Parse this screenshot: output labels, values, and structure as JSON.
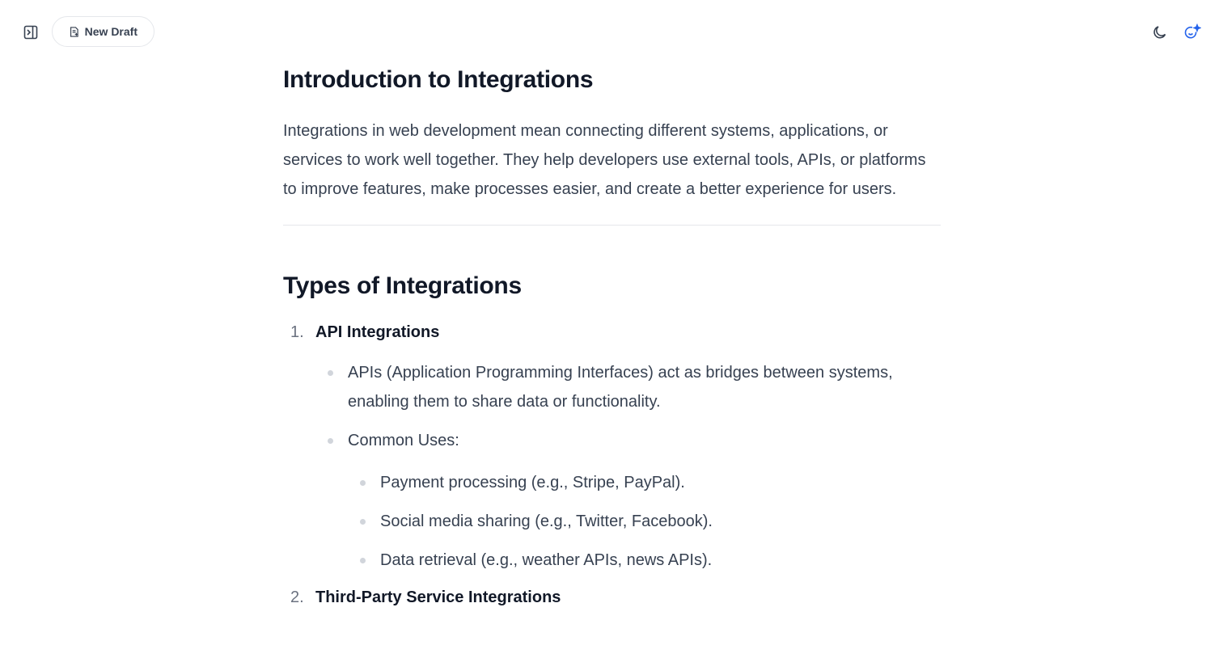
{
  "toolbar": {
    "new_draft_label": "New Draft",
    "sidebar_toggle_icon": "sidebar-toggle-icon",
    "theme_icon": "moon-icon",
    "ai_icon": "ai-sparkle-icon",
    "accent_color": "#2563eb"
  },
  "document": {
    "intro_heading": "Introduction to Integrations",
    "intro_paragraph": "Integrations in web development mean connecting different systems, applications, or services to work well together. They help developers use external tools, APIs, or platforms to improve features, make processes easier, and create a better experience for users.",
    "types_heading": "Types of Integrations",
    "list": [
      {
        "number": "1.",
        "title": "API Integrations",
        "bullets": [
          "APIs (Application Programming Interfaces) act as bridges between systems, enabling them to share data or functionality.",
          "Common Uses:"
        ],
        "sub_bullets": [
          "Payment processing (e.g., Stripe, PayPal).",
          "Social media sharing (e.g., Twitter, Facebook).",
          "Data retrieval (e.g., weather APIs, news APIs)."
        ]
      },
      {
        "number": "2.",
        "title": "Third-Party Service Integrations"
      }
    ]
  }
}
